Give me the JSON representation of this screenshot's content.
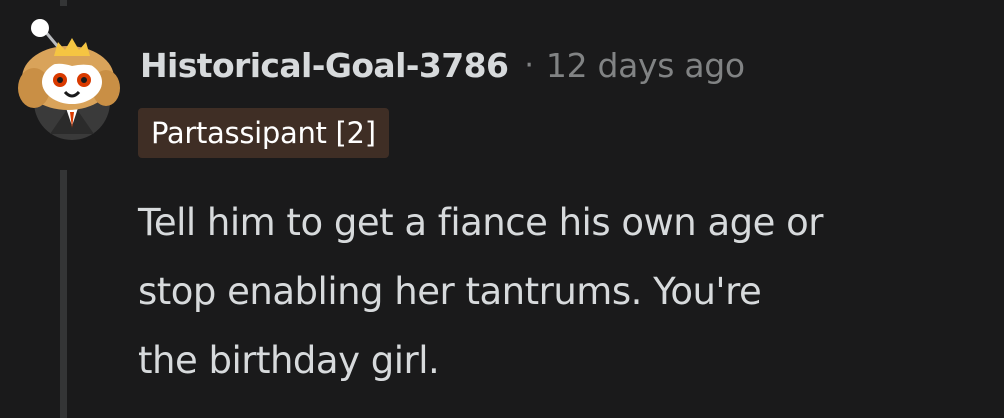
{
  "comment": {
    "username": "Historical-Goal-3786",
    "separator": "·",
    "timestamp": "12 days ago",
    "flair": "Partassipant [2]",
    "body_lines": [
      "Tell him to get a fiance his own age or",
      "stop enabling her tantrums. You're",
      "the birthday girl."
    ]
  },
  "avatar": {
    "icon": "snoo-avatar-icon",
    "colors": {
      "hair": "#d9a35a",
      "crown": "#f5c542",
      "suit": "#3a3a3a",
      "tie": "#d93a00"
    }
  },
  "colors": {
    "background": "#1a1a1b",
    "text_primary": "#d7dadc",
    "text_muted": "#818384",
    "flair_bg": "#3f2e25",
    "thread_line": "#343536"
  }
}
